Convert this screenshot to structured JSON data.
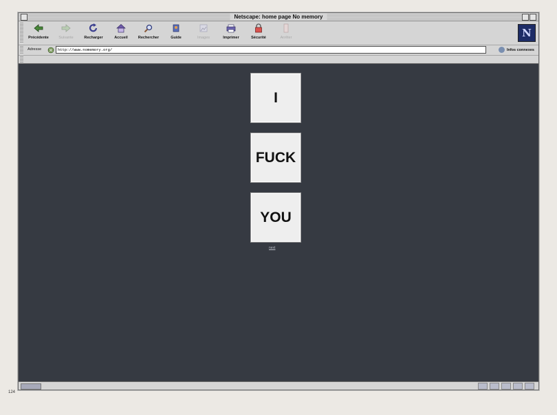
{
  "window": {
    "title": "Netscape: home page No memory"
  },
  "toolbar": {
    "buttons": [
      {
        "label": "Précédente",
        "icon": "back-arrow-icon",
        "enabled": true
      },
      {
        "label": "Suivante",
        "icon": "forward-arrow-icon",
        "enabled": false
      },
      {
        "label": "Recharger",
        "icon": "reload-icon",
        "enabled": true
      },
      {
        "label": "Accueil",
        "icon": "home-icon",
        "enabled": true
      },
      {
        "label": "Rechercher",
        "icon": "search-icon",
        "enabled": true
      },
      {
        "label": "Guide",
        "icon": "guide-icon",
        "enabled": true
      },
      {
        "label": "Images",
        "icon": "images-icon",
        "enabled": false
      },
      {
        "label": "Imprimer",
        "icon": "print-icon",
        "enabled": true
      },
      {
        "label": "Sécurité",
        "icon": "security-lock-icon",
        "enabled": true
      },
      {
        "label": "Arrêter",
        "icon": "stop-icon",
        "enabled": false
      }
    ],
    "logo": "N"
  },
  "location": {
    "label": "Adresse",
    "url": "http://www.nomemory.org/",
    "info_label": "Infos connexes"
  },
  "content": {
    "tiles": [
      "I",
      "FUCK",
      "YOU"
    ],
    "link": "next"
  },
  "page_number": "124",
  "colors": {
    "content_bg": "#363a42",
    "tile_bg": "#eeeeee",
    "chrome": "#d5d5d5"
  }
}
